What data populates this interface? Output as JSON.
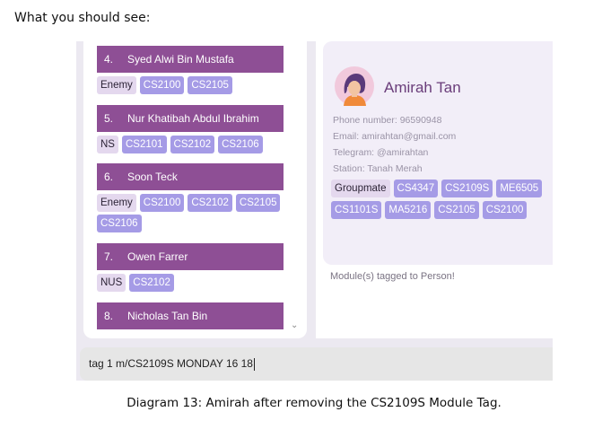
{
  "intro_text": "What you should see:",
  "persons": [
    {
      "index": "4.",
      "name": "Syed Alwi Bin Mustafa",
      "tags": [
        {
          "label": "Enemy",
          "kind": "group"
        },
        {
          "label": "CS2100",
          "kind": "module"
        },
        {
          "label": "CS2105",
          "kind": "module"
        }
      ]
    },
    {
      "index": "5.",
      "name": "Nur Khatibah Abdul Ibrahim",
      "tags": [
        {
          "label": "NS",
          "kind": "group"
        },
        {
          "label": "CS2101",
          "kind": "module"
        },
        {
          "label": "CS2102",
          "kind": "module"
        },
        {
          "label": "CS2106",
          "kind": "module"
        }
      ]
    },
    {
      "index": "6.",
      "name": "Soon Teck",
      "tags": [
        {
          "label": "Enemy",
          "kind": "group"
        },
        {
          "label": "CS2100",
          "kind": "module"
        },
        {
          "label": "CS2102",
          "kind": "module"
        },
        {
          "label": "CS2105",
          "kind": "module"
        },
        {
          "label": "CS2106",
          "kind": "module"
        }
      ]
    },
    {
      "index": "7.",
      "name": "Owen Farrer",
      "tags": [
        {
          "label": "NUS",
          "kind": "group"
        },
        {
          "label": "CS2102",
          "kind": "module"
        }
      ]
    },
    {
      "index": "8.",
      "name": "Nicholas Tan Bin",
      "tags": []
    }
  ],
  "detail": {
    "name": "Amirah Tan",
    "phone": "Phone number: 96590948",
    "email": "Email: amirahtan@gmail.com",
    "telegram": "Telegram: @amirahtan",
    "station": "Station: Tanah Merah",
    "tags": [
      {
        "label": "Groupmate",
        "kind": "group"
      },
      {
        "label": "CS4347",
        "kind": "module"
      },
      {
        "label": "CS2109S",
        "kind": "module"
      },
      {
        "label": "ME6505",
        "kind": "module"
      },
      {
        "label": "CS1101S",
        "kind": "module"
      },
      {
        "label": "MA5216",
        "kind": "module"
      },
      {
        "label": "CS2105",
        "kind": "module"
      },
      {
        "label": "CS2100",
        "kind": "module"
      }
    ]
  },
  "result_message": "Module(s) tagged to Person!",
  "command_input": "tag 1 m/CS2109S MONDAY 16 18",
  "caption": "Diagram 13: Amirah after removing the CS2109S Module Tag.",
  "colors": {
    "card_header": "#8e4f95",
    "module_tag": "#a59be6",
    "group_tag": "#e4d8ee",
    "name": "#6a3d7a"
  },
  "icons": {
    "avatar": "person-avatar-icon",
    "scroll": "chevron-down-icon"
  }
}
